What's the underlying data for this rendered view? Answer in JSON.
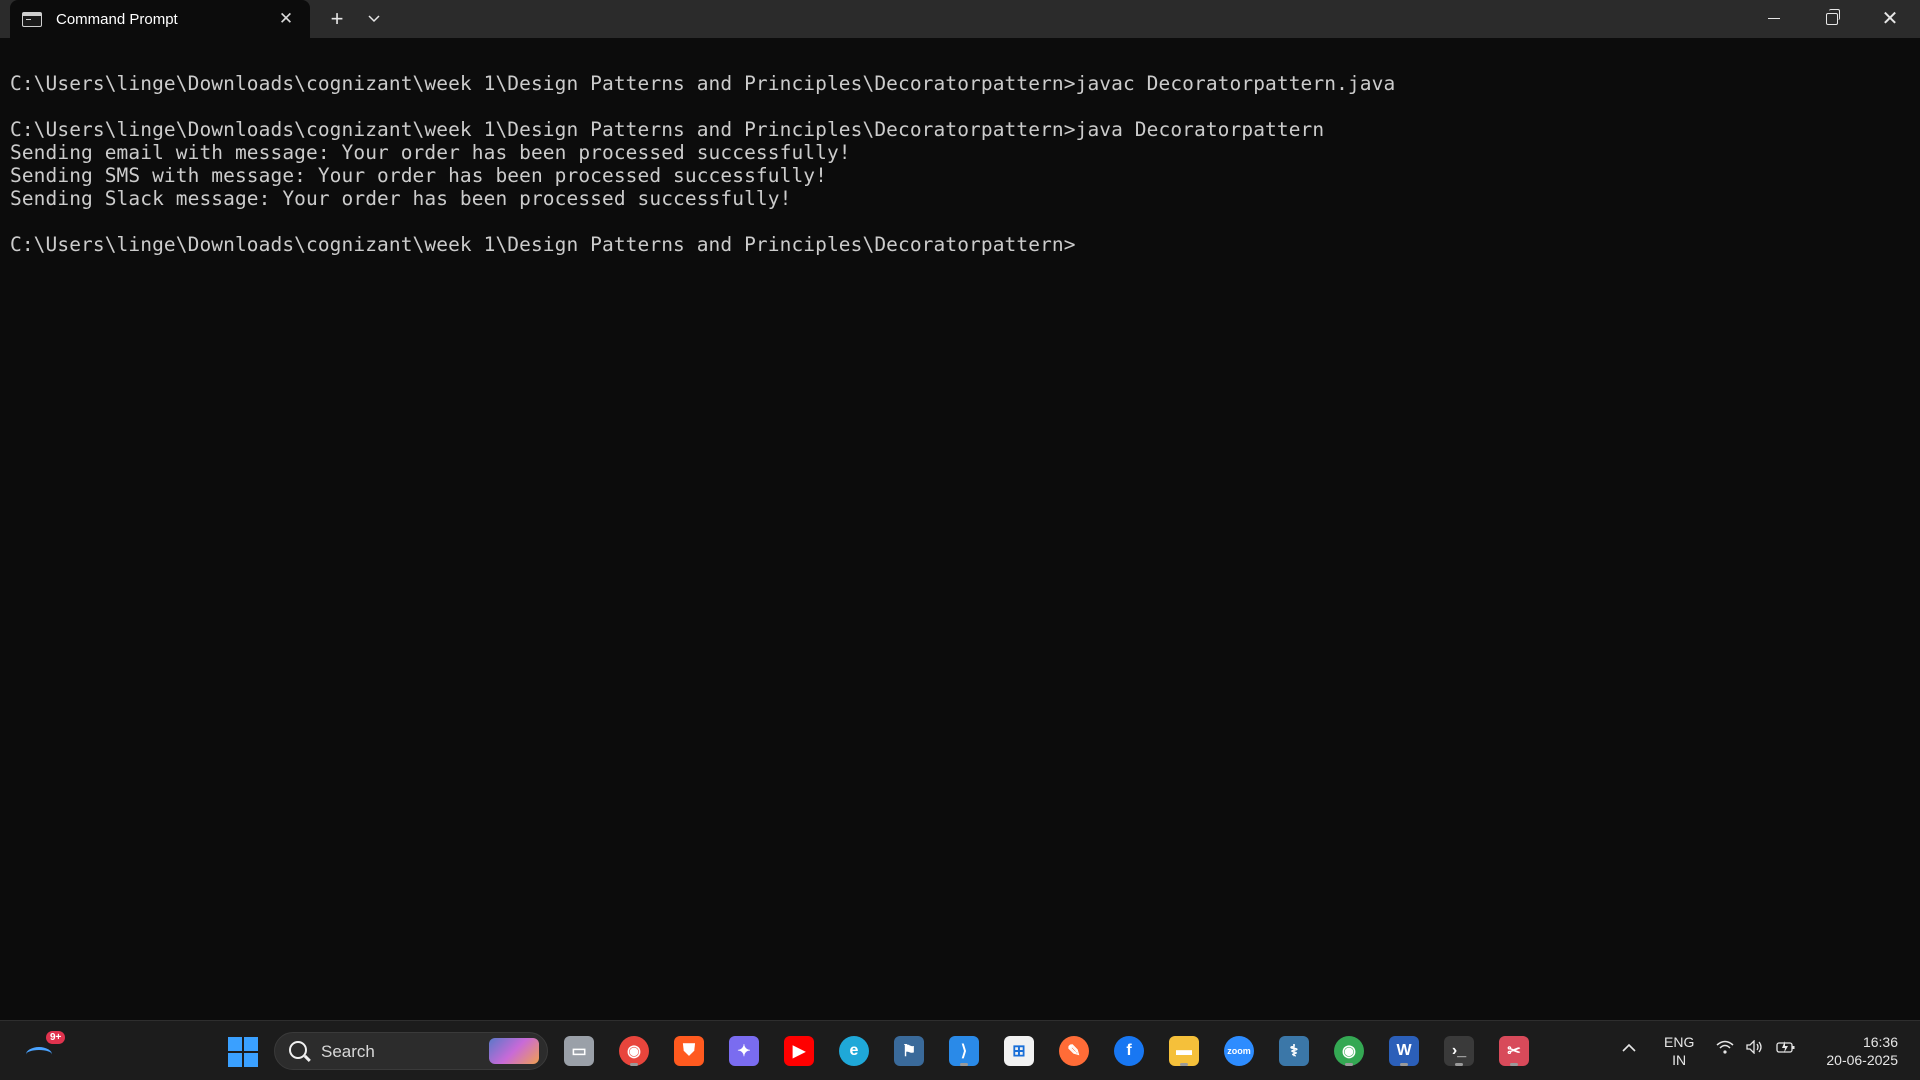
{
  "window": {
    "tab_title": "Command Prompt",
    "tab_close": "✕",
    "new_tab": "+",
    "tab_dropdown": "⌄",
    "close": "✕"
  },
  "terminal": {
    "lines": [
      "C:\\Users\\linge\\Downloads\\cognizant\\week 1\\Design Patterns and Principles\\Decoratorpattern>javac Decoratorpattern.java",
      "",
      "C:\\Users\\linge\\Downloads\\cognizant\\week 1\\Design Patterns and Principles\\Decoratorpattern>java Decoratorpattern",
      "Sending email with message: Your order has been processed successfully!",
      "Sending SMS with message: Your order has been processed successfully!",
      "Sending Slack message: Your order has been processed successfully!",
      "",
      "C:\\Users\\linge\\Downloads\\cognizant\\week 1\\Design Patterns and Principles\\Decoratorpattern>"
    ]
  },
  "taskbar": {
    "widget_badge": "9+",
    "search_label": "Search",
    "apps": [
      {
        "name": "task-view-icon",
        "color": "#9aa0a8"
      },
      {
        "name": "chrome-icon",
        "color": "#e8453c"
      },
      {
        "name": "brave-icon",
        "color": "#ff5a1f"
      },
      {
        "name": "copilot-icon",
        "color": "#7a6cf0"
      },
      {
        "name": "youtube-icon",
        "color": "#ff0000"
      },
      {
        "name": "edge-icon",
        "color": "#1fa8d8"
      },
      {
        "name": "mysql-workbench-icon",
        "color": "#3a6a9a"
      },
      {
        "name": "vscode-icon",
        "color": "#2a8ae8"
      },
      {
        "name": "microsoft-store-icon",
        "color": "#f2f2f2"
      },
      {
        "name": "postman-icon",
        "color": "#ff6c37"
      },
      {
        "name": "facebook-icon",
        "color": "#1877f2"
      },
      {
        "name": "file-explorer-icon",
        "color": "#f5c03a"
      },
      {
        "name": "zoom-icon",
        "color": "#2d8cff"
      },
      {
        "name": "python-icon",
        "color": "#3b77a8"
      },
      {
        "name": "chrome-profile-icon",
        "color": "#34a853"
      },
      {
        "name": "word-icon",
        "color": "#2b5fb9"
      },
      {
        "name": "terminal-icon",
        "color": "#3a3a3a"
      },
      {
        "name": "snipping-tool-icon",
        "color": "#d84a5a"
      }
    ],
    "apps_glyphs": [
      "▭",
      "◉",
      "⛊",
      "✦",
      "▶",
      "e",
      "⚑",
      "⟩",
      "⊞",
      "✎",
      "f",
      "▬",
      "zoom",
      "⚕",
      "◉",
      "W",
      "›_",
      "✂"
    ],
    "lang_line1": "ENG",
    "lang_line2": "IN",
    "time": "16:36",
    "date": "20-06-2025"
  }
}
